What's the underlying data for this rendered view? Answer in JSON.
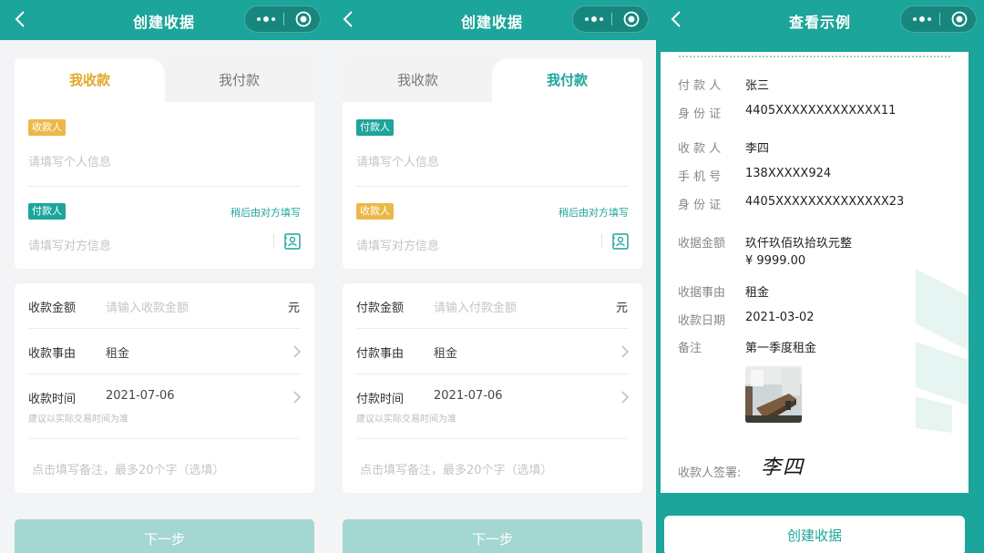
{
  "colors": {
    "brand": "#1ca59a",
    "accent_yellow": "#edb84a",
    "disabled_button": "#a4d7d1"
  },
  "panel1": {
    "nav": {
      "title": "创建收据",
      "back_icon": "chevron-left-icon",
      "more_icon": "more-dots-icon",
      "target_icon": "target-circle-icon"
    },
    "tabs": [
      {
        "label": "我收款",
        "active": true
      },
      {
        "label": "我付款",
        "active": false
      }
    ],
    "first_tag": "收款人",
    "first_placeholder": "请填写个人信息",
    "second_tag": "付款人",
    "later_link": "稍后由对方填写",
    "second_placeholder": "请填写对方信息",
    "amount": {
      "label": "收款金额",
      "placeholder": "请输入收款金额",
      "unit": "元"
    },
    "reason": {
      "label": "收款事由",
      "value": "租金"
    },
    "time": {
      "label": "收款时间",
      "value": "2021-07-06",
      "hint": "建议以实际交易时间为准"
    },
    "note_placeholder": "点击填写备注，最多20个字（选填）",
    "next_button": "下一步"
  },
  "panel2": {
    "nav": {
      "title": "创建收据",
      "back_icon": "chevron-left-icon",
      "more_icon": "more-dots-icon",
      "target_icon": "target-circle-icon"
    },
    "tabs": [
      {
        "label": "我收款",
        "active": false
      },
      {
        "label": "我付款",
        "active": true
      }
    ],
    "first_tag": "付款人",
    "first_placeholder": "请填写个人信息",
    "second_tag": "收款人",
    "later_link": "稍后由对方填写",
    "second_placeholder": "请填写对方信息",
    "amount": {
      "label": "付款金额",
      "placeholder": "请输入付款金额",
      "unit": "元"
    },
    "reason": {
      "label": "付款事由",
      "value": "租金"
    },
    "time": {
      "label": "付款时间",
      "value": "2021-07-06",
      "hint": "建议以实际交易时间为准"
    },
    "note_placeholder": "点击填写备注，最多20个字（选填）",
    "next_button": "下一步"
  },
  "panel3": {
    "nav": {
      "title": "查看示例",
      "back_icon": "chevron-left-icon",
      "more_icon": "more-dots-icon",
      "target_icon": "target-circle-icon"
    },
    "receipt": {
      "payer_label": "付 款 人",
      "payer_name": "张三",
      "payer_id_label": "身 份 证",
      "payer_id": "4405XXXXXXXXXXXXX11",
      "payee_label": "收 款 人",
      "payee_name": "李四",
      "payee_phone_label": "手 机 号",
      "payee_phone": "138XXXXX924",
      "payee_id_label": "身 份 证",
      "payee_id": "4405XXXXXXXXXXXXXX23",
      "amount_label": "收据金额",
      "amount_words": "玖仟玖佰玖拾玖元整",
      "amount_number": "¥ 9999.00",
      "reason_label": "收据事由",
      "reason": "租金",
      "date_label": "收款日期",
      "date": "2021-03-02",
      "note_label": "备注",
      "note": "第一季度租金",
      "signature_label": "收款人签署:",
      "signature": "李四"
    },
    "create_button": "创建收据"
  }
}
